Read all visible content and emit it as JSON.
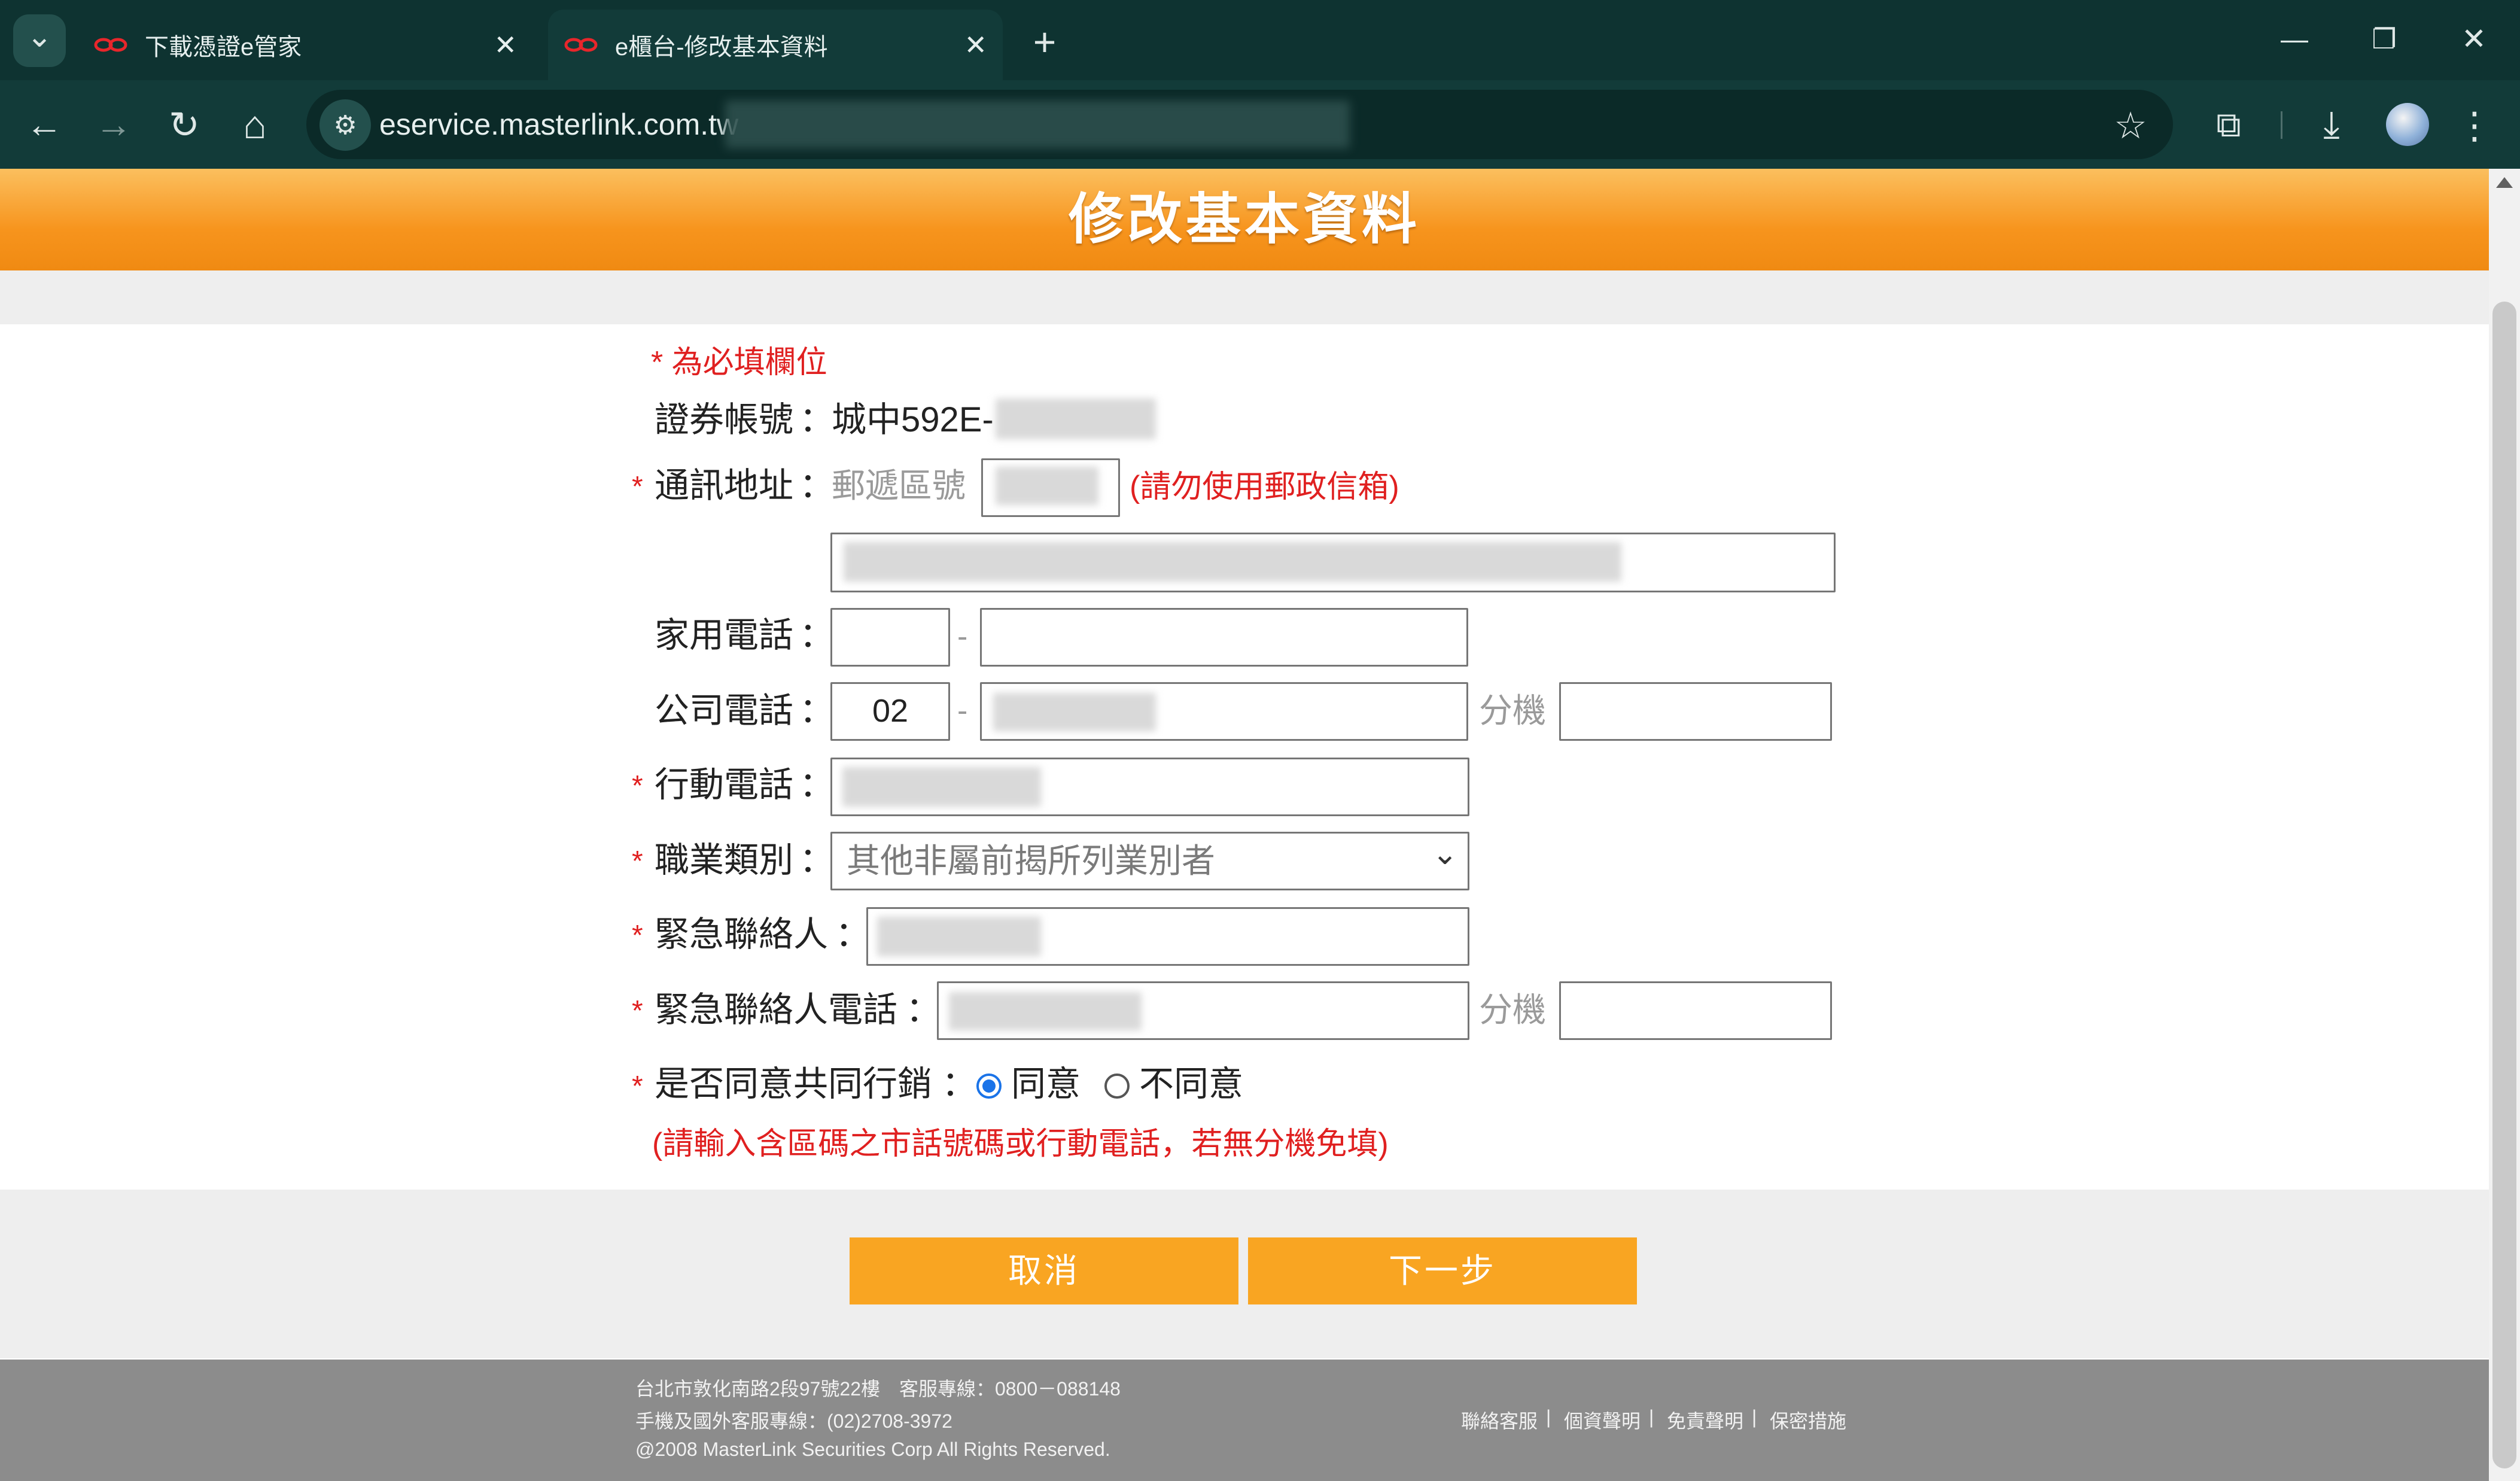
{
  "browser": {
    "tabs": [
      {
        "title": "下載憑證e管家",
        "active": false
      },
      {
        "title": "e櫃台-修改基本資料",
        "active": true
      }
    ],
    "new_tab": "+",
    "url": "eservice.masterlink.com.tw",
    "window": {
      "minimize": "—",
      "restore": "❐",
      "close": "✕"
    },
    "icons": {
      "back": "←",
      "forward": "→",
      "reload": "↻",
      "home": "⌂",
      "star": "☆",
      "extensions": "⧉",
      "download": "⤓",
      "menu": "⋮",
      "tab_search": "⌄",
      "site_info": "⚙",
      "tab_close": "✕"
    },
    "colors": {
      "chrome_dark": "#0e3331",
      "toolbar": "#123b39"
    }
  },
  "page": {
    "title": "修改基本資料",
    "required_note": "* 為必填欄位",
    "star": "*",
    "colon": "：",
    "account": {
      "label": "證券帳號",
      "value": "城中592E-"
    },
    "address": {
      "label": "通訊地址",
      "zip_label": "郵遞區號",
      "note": "(請勿使用郵政信箱)"
    },
    "home_phone": {
      "label": "家用電話",
      "area": "",
      "number": "",
      "dash": "-"
    },
    "office_phone": {
      "label": "公司電話",
      "area": "02",
      "dash": "-",
      "ext_label": "分機",
      "ext": ""
    },
    "mobile": {
      "label": "行動電話"
    },
    "occupation": {
      "label": "職業類別",
      "selected": "其他非屬前揭所列業別者",
      "chevron": "⌄"
    },
    "emergency_contact": {
      "label": "緊急聯絡人"
    },
    "emergency_phone": {
      "label": "緊急聯絡人電話",
      "ext_label": "分機",
      "ext": ""
    },
    "marketing": {
      "label": "是否同意共同行銷",
      "agree": "同意",
      "disagree": "不同意",
      "selected": "agree"
    },
    "phone_note": "(請輸入含區碼之市話號碼或行動電話，若無分機免填)",
    "buttons": {
      "cancel": "取消",
      "next": "下一步"
    },
    "footer": {
      "line1": "台北市敦化南路2段97號22樓　客服專線：0800－088148",
      "line2": "手機及國外客服專線：(02)2708-3972",
      "line3": "@2008 MasterLink Securities Corp All Rights Reserved.",
      "links": [
        "聯絡客服",
        "個資聲明",
        "免責聲明",
        "保密措施"
      ],
      "sep": "|"
    },
    "colors": {
      "accent": "#f7941d",
      "button": "#f9a522",
      "required": "#e02020",
      "footer_bg": "#8c8c8c"
    }
  }
}
